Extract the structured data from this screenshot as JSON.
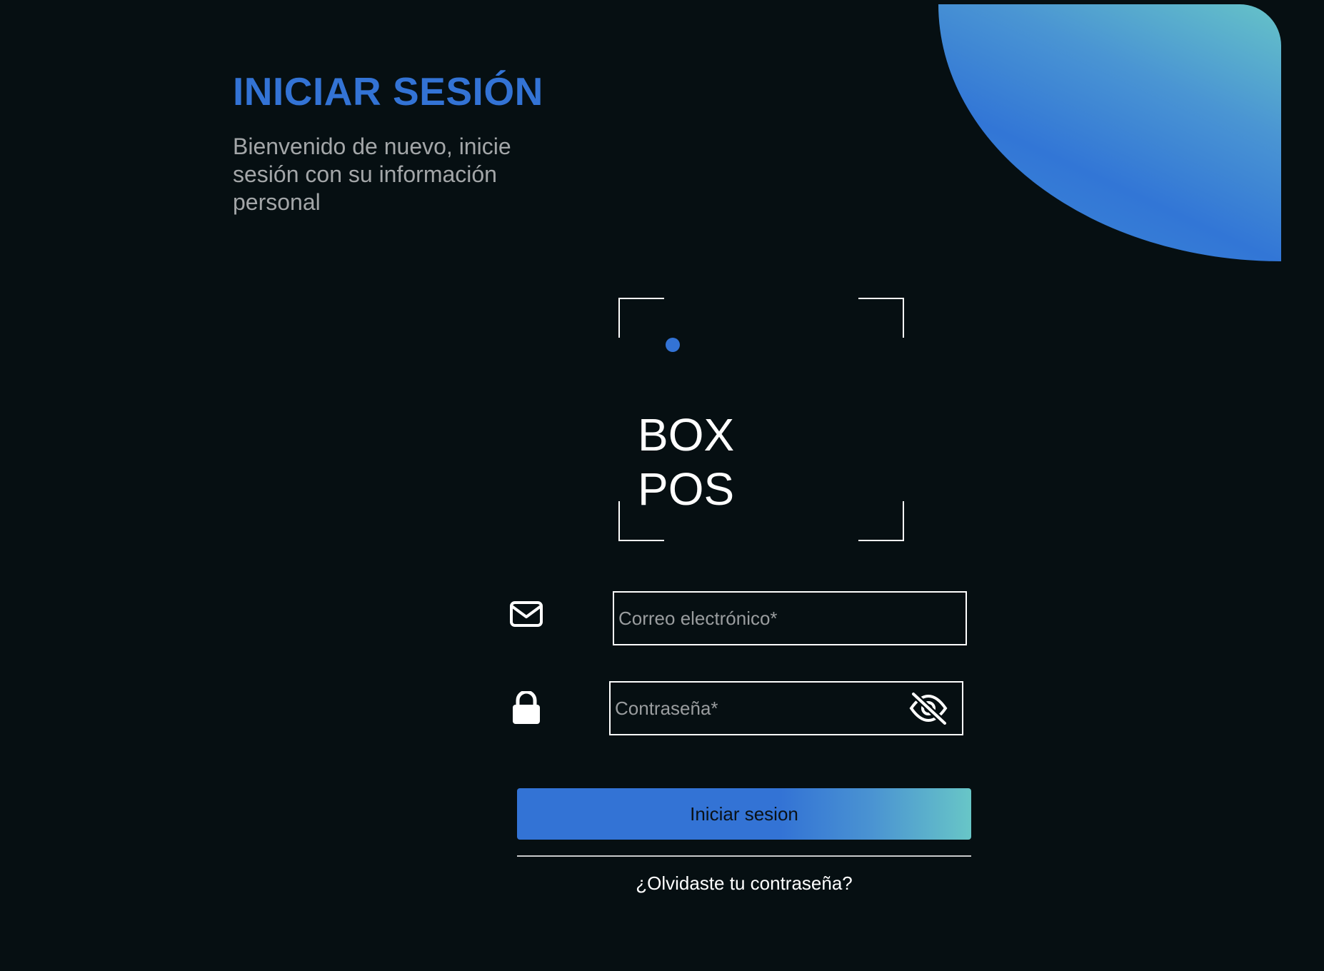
{
  "header": {
    "title": "INICIAR SESIÓN",
    "subtitle": "Bienvenido de nuevo, inicie sesión con su información personal"
  },
  "logo": {
    "line1": "BOX",
    "line2": "POS"
  },
  "form": {
    "email": {
      "icon": "envelope-icon",
      "placeholder": "Correo electrónico*",
      "value": ""
    },
    "password": {
      "icon": "lock-icon",
      "placeholder": "Contraseña*",
      "value": "",
      "visibility_icon": "eye-slash-icon"
    },
    "submit_label": "Iniciar sesion",
    "forgot_label": "¿Olvidaste tu contraseña?"
  },
  "colors": {
    "background": "#060f12",
    "accent": "#3373d5",
    "gradient_end": "#68c6c7",
    "subtitle": "#a3a6a8"
  }
}
